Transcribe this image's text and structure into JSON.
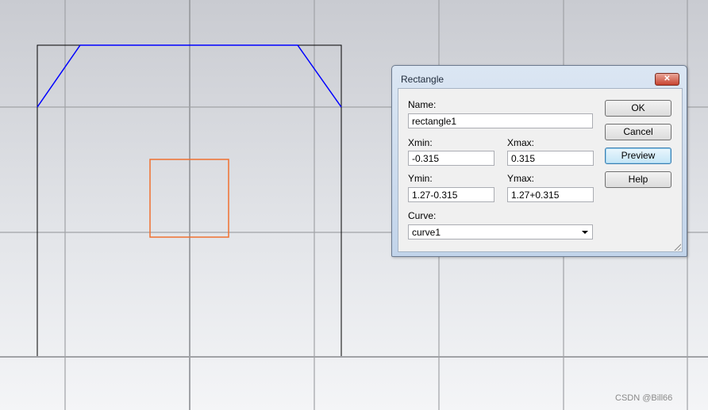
{
  "dialog": {
    "title": "Rectangle",
    "close_label": "✕",
    "name_label": "Name:",
    "name_value": "rectangle1",
    "xmin_label": "Xmin:",
    "xmin_value": "-0.315",
    "xmax_label": "Xmax:",
    "xmax_value": "0.315",
    "ymin_label": "Ymin:",
    "ymin_value": "1.27-0.315",
    "ymax_label": "Ymax:",
    "ymax_value": "1.27+0.315",
    "curve_label": "Curve:",
    "curve_value": "curve1",
    "buttons": {
      "ok": "OK",
      "cancel": "Cancel",
      "preview": "Preview",
      "help": "Help"
    }
  },
  "watermark": "CSDN @Bill66",
  "colors": {
    "outline": "#000000",
    "chamfer": "#0000ff",
    "selection": "#f07030",
    "grid": "#a0a0a0"
  }
}
